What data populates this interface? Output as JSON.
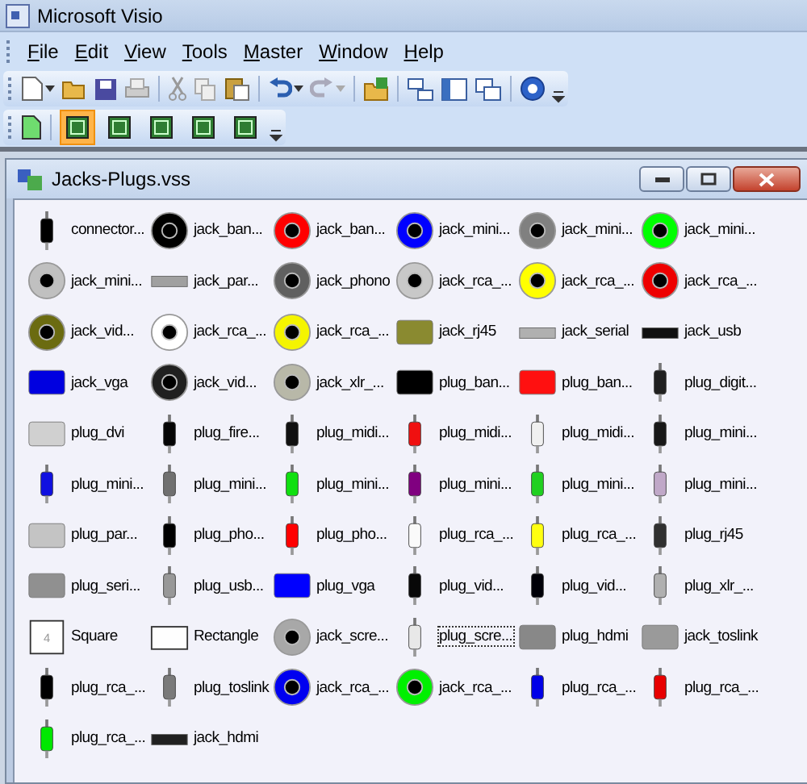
{
  "window": {
    "title": "Microsoft Visio"
  },
  "menu": [
    "File",
    "Edit",
    "View",
    "Tools",
    "Master",
    "Window",
    "Help"
  ],
  "view_buttons": [
    {
      "selected": true
    },
    {
      "selected": false
    },
    {
      "selected": false
    },
    {
      "selected": false
    },
    {
      "selected": false
    }
  ],
  "stencil": {
    "title": "Jacks-Plugs.vss",
    "masters": [
      {
        "label": "connector...",
        "kind": "plug",
        "color": "#000000",
        "selected": false
      },
      {
        "label": "jack_ban...",
        "kind": "jack",
        "color": "#000000",
        "selected": false
      },
      {
        "label": "jack_ban...",
        "kind": "jack",
        "color": "#ff0000",
        "selected": false
      },
      {
        "label": "jack_mini...",
        "kind": "jack",
        "color": "#0000ff",
        "selected": false
      },
      {
        "label": "jack_mini...",
        "kind": "jack",
        "color": "#808080",
        "selected": false
      },
      {
        "label": "jack_mini...",
        "kind": "jack",
        "color": "#00ff00",
        "selected": false
      },
      {
        "label": "jack_mini...",
        "kind": "jack",
        "color": "#c0c0c0",
        "selected": false
      },
      {
        "label": "jack_par...",
        "kind": "strip",
        "color": "#a0a0a0",
        "selected": false
      },
      {
        "label": "jack_phono",
        "kind": "jack",
        "color": "#606060",
        "selected": false
      },
      {
        "label": "jack_rca_...",
        "kind": "jack",
        "color": "#c8c8c8",
        "selected": false
      },
      {
        "label": "jack_rca_...",
        "kind": "jack",
        "color": "#ffff00",
        "selected": false
      },
      {
        "label": "jack_rca_...",
        "kind": "jack",
        "color": "#ee0000",
        "selected": false
      },
      {
        "label": "jack_vid...",
        "kind": "jack",
        "color": "#6b6b10",
        "selected": false
      },
      {
        "label": "jack_rca_...",
        "kind": "jack",
        "color": "#ffffff",
        "selected": false
      },
      {
        "label": "jack_rca_...",
        "kind": "jack",
        "color": "#f5f500",
        "selected": false
      },
      {
        "label": "jack_rj45",
        "kind": "block",
        "color": "#8a8a30",
        "selected": false
      },
      {
        "label": "jack_serial",
        "kind": "strip",
        "color": "#b0b0b0",
        "selected": false
      },
      {
        "label": "jack_usb",
        "kind": "strip",
        "color": "#101010",
        "selected": false
      },
      {
        "label": "jack_vga",
        "kind": "block",
        "color": "#0000e0",
        "selected": false
      },
      {
        "label": "jack_vid...",
        "kind": "jack",
        "color": "#202020",
        "selected": false
      },
      {
        "label": "jack_xlr_...",
        "kind": "jack",
        "color": "#b8b8a8",
        "selected": false
      },
      {
        "label": "plug_ban...",
        "kind": "block",
        "color": "#000000",
        "selected": false
      },
      {
        "label": "plug_ban...",
        "kind": "block",
        "color": "#ff1010",
        "selected": false
      },
      {
        "label": "plug_digit...",
        "kind": "plug",
        "color": "#202020",
        "selected": false
      },
      {
        "label": "plug_dvi",
        "kind": "block",
        "color": "#d0d0d0",
        "selected": false
      },
      {
        "label": "plug_fire...",
        "kind": "plug",
        "color": "#050505",
        "selected": false
      },
      {
        "label": "plug_midi...",
        "kind": "plug",
        "color": "#101010",
        "selected": false
      },
      {
        "label": "plug_midi...",
        "kind": "plug",
        "color": "#f01010",
        "selected": false
      },
      {
        "label": "plug_midi...",
        "kind": "plug",
        "color": "#f0f0f0",
        "selected": false
      },
      {
        "label": "plug_mini...",
        "kind": "plug",
        "color": "#181818",
        "selected": false
      },
      {
        "label": "plug_mini...",
        "kind": "plug",
        "color": "#1010e0",
        "selected": false
      },
      {
        "label": "plug_mini...",
        "kind": "plug",
        "color": "#707070",
        "selected": false
      },
      {
        "label": "plug_mini...",
        "kind": "plug",
        "color": "#10e010",
        "selected": false
      },
      {
        "label": "plug_mini...",
        "kind": "plug",
        "color": "#800080",
        "selected": false
      },
      {
        "label": "plug_mini...",
        "kind": "plug",
        "color": "#20d020",
        "selected": false
      },
      {
        "label": "plug_mini...",
        "kind": "plug",
        "color": "#c0a8c8",
        "selected": false
      },
      {
        "label": "plug_par...",
        "kind": "block",
        "color": "#c4c4c4",
        "selected": false
      },
      {
        "label": "plug_pho...",
        "kind": "plug",
        "color": "#000000",
        "selected": false
      },
      {
        "label": "plug_pho...",
        "kind": "plug",
        "color": "#ff0000",
        "selected": false
      },
      {
        "label": "plug_rca_...",
        "kind": "plug",
        "color": "#fafafa",
        "selected": false
      },
      {
        "label": "plug_rca_...",
        "kind": "plug",
        "color": "#ffff10",
        "selected": false
      },
      {
        "label": "plug_rj45",
        "kind": "plug",
        "color": "#303030",
        "selected": false
      },
      {
        "label": "plug_seri...",
        "kind": "block",
        "color": "#909090",
        "selected": false
      },
      {
        "label": "plug_usb...",
        "kind": "plug",
        "color": "#989898",
        "selected": false
      },
      {
        "label": "plug_vga",
        "kind": "block",
        "color": "#0000ff",
        "selected": false
      },
      {
        "label": "plug_vid...",
        "kind": "plug",
        "color": "#080808",
        "selected": false
      },
      {
        "label": "plug_vid...",
        "kind": "plug",
        "color": "#000008",
        "selected": false
      },
      {
        "label": "plug_xlr_...",
        "kind": "plug",
        "color": "#b0b0b0",
        "selected": false
      },
      {
        "label": "Square",
        "kind": "square",
        "inner": "4",
        "color": "#ffffff",
        "selected": false
      },
      {
        "label": "Rectangle",
        "kind": "rect",
        "color": "#fefefe",
        "selected": false
      },
      {
        "label": "jack_scre...",
        "kind": "jack",
        "color": "#a8a8a8",
        "selected": false
      },
      {
        "label": "plug_scre...",
        "kind": "plug",
        "color": "#e8e8e8",
        "selected": true
      },
      {
        "label": "plug_hdmi",
        "kind": "block",
        "color": "#888888",
        "selected": false
      },
      {
        "label": "jack_toslink",
        "kind": "block",
        "color": "#9a9a9a",
        "selected": false
      },
      {
        "label": "plug_rca_...",
        "kind": "plug",
        "color": "#000001",
        "selected": false
      },
      {
        "label": "plug_toslink",
        "kind": "plug",
        "color": "#7a7a7a",
        "selected": false
      },
      {
        "label": "jack_rca_...",
        "kind": "jack",
        "color": "#0000f0",
        "selected": false
      },
      {
        "label": "jack_rca_...",
        "kind": "jack",
        "color": "#00f000",
        "selected": false
      },
      {
        "label": "plug_rca_...",
        "kind": "plug",
        "color": "#0000e8",
        "selected": false
      },
      {
        "label": "plug_rca_...",
        "kind": "plug",
        "color": "#e80000",
        "selected": false
      },
      {
        "label": "plug_rca_...",
        "kind": "plug",
        "color": "#00e800",
        "selected": false
      },
      {
        "label": "jack_hdmi",
        "kind": "strip",
        "color": "#202020",
        "selected": false
      }
    ]
  }
}
